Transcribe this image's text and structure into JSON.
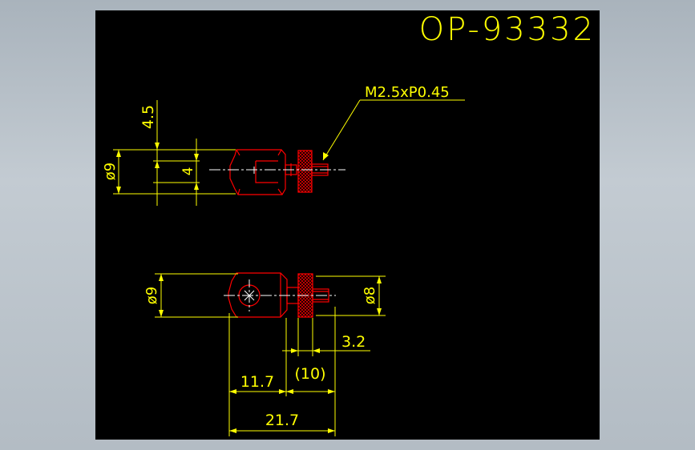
{
  "drawing": {
    "title": "OP-93332",
    "thread_callout": "M2.5xP0.45",
    "top_view": {
      "dim_height": "4.5",
      "dim_diameter": "ø9",
      "dim_slot": "4"
    },
    "front_view": {
      "dim_left_diameter": "ø9",
      "dim_right_diameter": "ø8",
      "dim_3_2": "3.2",
      "dim_11_7": "11.7",
      "dim_10": "(10)",
      "dim_21_7": "21.7"
    },
    "colors": {
      "background": "#000000",
      "dimension": "#ffff00",
      "outline": "#ff0000",
      "center": "#ffffff"
    }
  }
}
